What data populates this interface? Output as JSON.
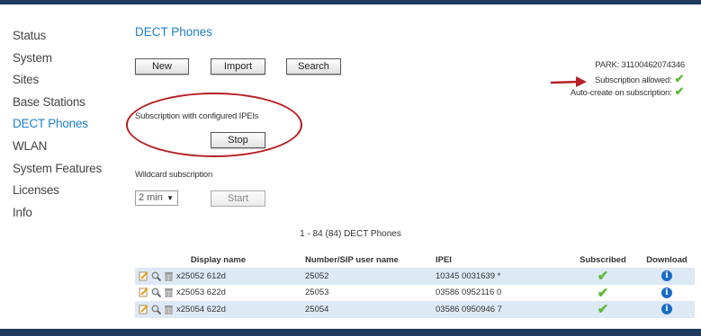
{
  "sidebar": {
    "items": [
      {
        "label": "Status"
      },
      {
        "label": "System"
      },
      {
        "label": "Sites"
      },
      {
        "label": "Base Stations"
      },
      {
        "label": "DECT Phones",
        "active": true
      },
      {
        "label": "WLAN"
      },
      {
        "label": "System Features"
      },
      {
        "label": "Licenses"
      },
      {
        "label": "Info"
      }
    ]
  },
  "main": {
    "title": "DECT Phones",
    "buttons": {
      "new": "New",
      "import": "Import",
      "search": "Search",
      "stop": "Stop",
      "start": "Start"
    },
    "subscription_configured_label": "Subscription with configured IPEIs",
    "wildcard_label": "Wildcard subscription",
    "wildcard_duration": "2 min"
  },
  "status": {
    "park": "PARK: 31100462074346",
    "subscription_allowed": "Subscription allowed:",
    "auto_create": "Auto-create on subscription:"
  },
  "table": {
    "caption": "1 - 84 (84) DECT Phones",
    "headers": {
      "display_name": "Display name",
      "number": "Number/SIP user name",
      "ipei": "IPEI",
      "subscribed": "Subscribed",
      "download": "Download"
    },
    "rows": [
      {
        "display_name": "x25052 612d",
        "number": "25052",
        "ipei": "10345 0031639 *"
      },
      {
        "display_name": "x25053 622d",
        "number": "25053",
        "ipei": "03586 0952116 0"
      },
      {
        "display_name": "x25054 622d",
        "number": "25054",
        "ipei": "03586 0950946 7"
      }
    ]
  },
  "colors": {
    "accent": "#1f7fc9",
    "check": "#5db83a",
    "annotation": "#b52025",
    "frame": "#1e3a5f"
  },
  "icons": [
    "edit-icon",
    "magnifier-icon",
    "trash-icon",
    "checkmark-icon",
    "info-icon",
    "dropdown-arrow-icon"
  ]
}
